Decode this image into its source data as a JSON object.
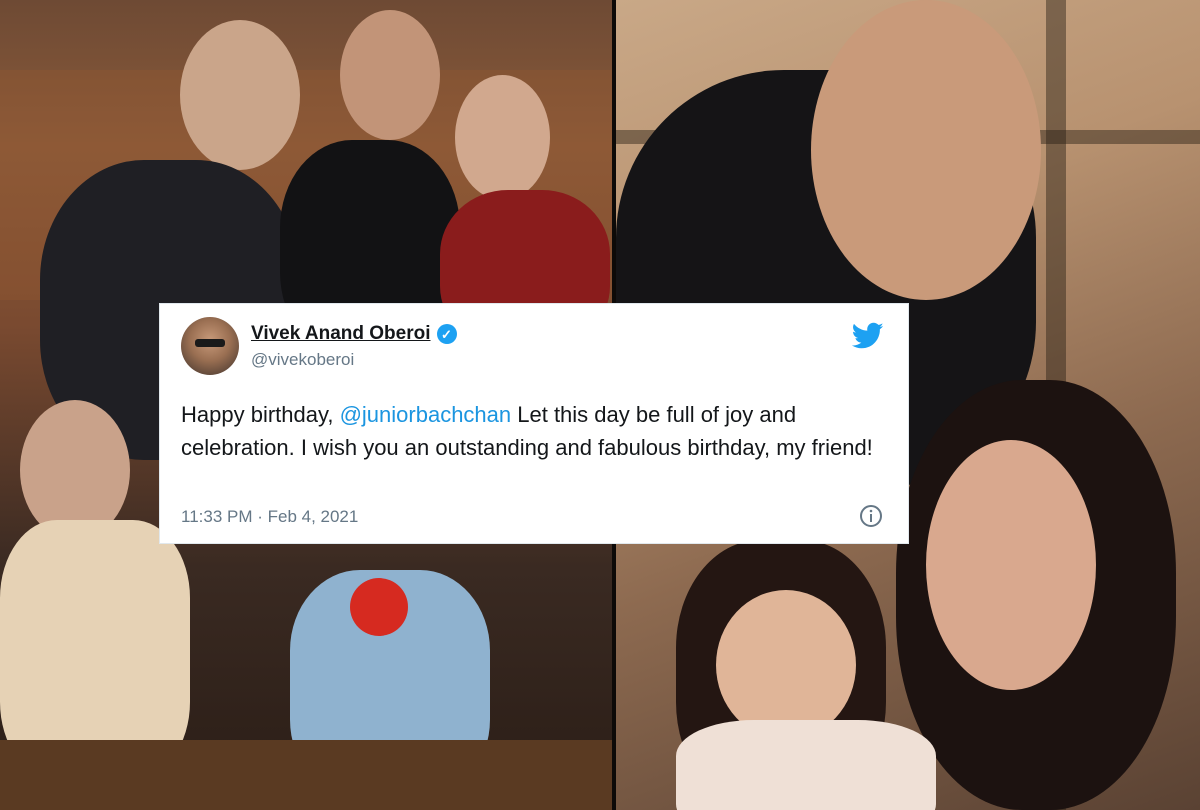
{
  "tweet": {
    "display_name": "Vivek Anand Oberoi",
    "handle": "@vivekoberoi",
    "text_before": "Happy birthday, ",
    "mention": "@juniorbachchan",
    "text_after": " Let this day be full of joy and celebration. I wish you an outstanding and fabulous birthday, my friend!",
    "timestamp": "11:33 PM · Feb 4, 2021",
    "verified": true
  },
  "icons": {
    "brand": "twitter-bird-icon",
    "verified": "verified-badge-icon",
    "info": "info-icon"
  },
  "colors": {
    "twitter_blue": "#1da1f2",
    "mention_blue": "#1b95e0",
    "secondary_text": "#657786"
  }
}
